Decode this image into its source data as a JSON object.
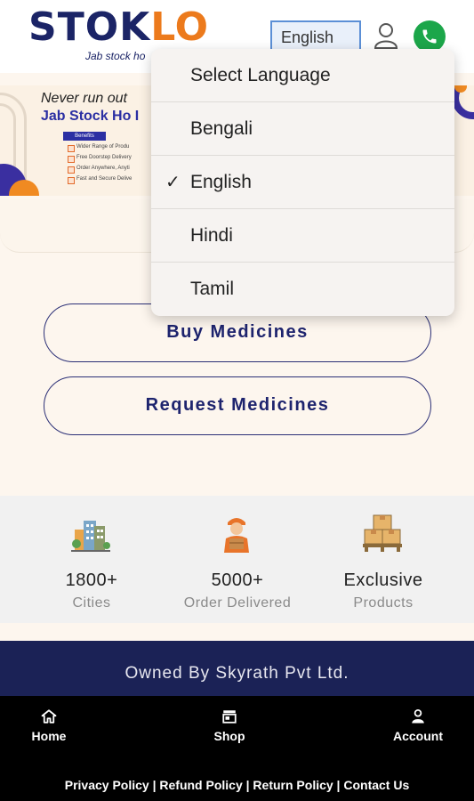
{
  "header": {
    "logo_part1": "STOK",
    "logo_part2": "LO",
    "tagline": "Jab stock ho",
    "language_value": "English",
    "colors": {
      "brand_navy": "#1b2466",
      "brand_orange": "#ec7a1c",
      "call_green": "#1ca64a"
    }
  },
  "banner": {
    "line1": "Never run out",
    "line2": "Jab Stock Ho I",
    "benefits_label": "Benefits",
    "benefits": [
      "Wider Range of Produ",
      "Free Doorstep Delivery",
      "Order Anywhere, Anyti",
      "Fast and Secure Delive"
    ]
  },
  "language_menu": {
    "title": "Select Language",
    "selected": "English",
    "options": [
      "Bengali",
      "English",
      "Hindi",
      "Tamil"
    ]
  },
  "actions": {
    "buy_label": "Buy Medicines",
    "request_label": "Request Medicines"
  },
  "stats": [
    {
      "value": "1800+",
      "label": "Cities",
      "icon": "city-buildings-icon"
    },
    {
      "value": "5000+",
      "label": "Order Delivered",
      "icon": "delivery-person-icon"
    },
    {
      "value": "Exclusive",
      "label": "Products",
      "icon": "stacked-boxes-icon"
    }
  ],
  "footer": {
    "owned_by": "Owned By Skyrath Pvt Ltd.",
    "nav": [
      {
        "label": "Home",
        "icon": "home-icon"
      },
      {
        "label": "Shop",
        "icon": "shop-icon"
      },
      {
        "label": "Account",
        "icon": "account-icon"
      }
    ],
    "links_text": "Privacy Policy | Refund Policy | Return Policy | Contact Us"
  }
}
